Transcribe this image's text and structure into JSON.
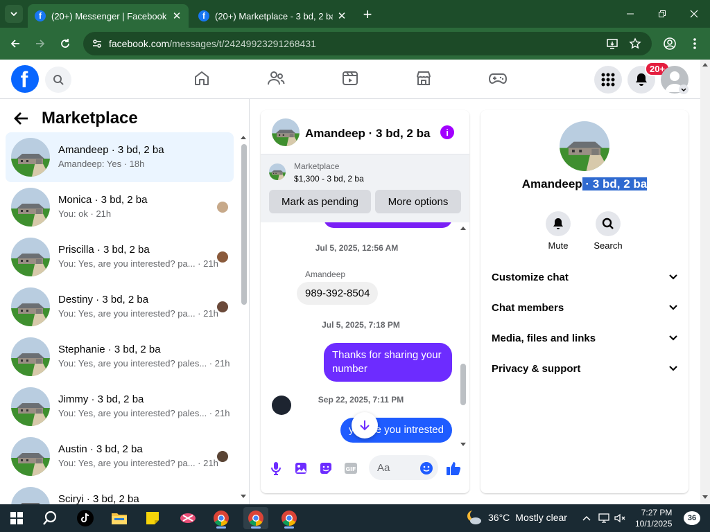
{
  "browser": {
    "tabs": [
      {
        "title": "(20+) Messenger | Facebook",
        "active": true
      },
      {
        "title": "(20+) Marketplace - 3 bd, 2 ba |",
        "active": false
      }
    ],
    "url_domain": "facebook.com",
    "url_path": "/messages/t/24249923291268431"
  },
  "fb_header": {
    "logo": "f",
    "notifications_badge": "20+",
    "nav_icons": [
      "home-icon",
      "friends-icon",
      "video-icon",
      "marketplace-icon",
      "gaming-icon"
    ]
  },
  "left_pane": {
    "title": "Marketplace",
    "conversations": [
      {
        "name": "Amandeep · 3 bd, 2 ba",
        "preview": "Amandeep: Yes · 18h",
        "selected": true
      },
      {
        "name": "Monica · 3 bd, 2 ba",
        "preview": "You: ok · 21h"
      },
      {
        "name": "Priscilla · 3 bd, 2 ba",
        "preview": "You: Yes, are you interested? pa... · 21h"
      },
      {
        "name": "Destiny · 3 bd, 2 ba",
        "preview": "You: Yes, are you interested? pa... · 21h"
      },
      {
        "name": "Stephanie · 3 bd, 2 ba",
        "preview": "You: Yes, are you interested? pales... · 21h"
      },
      {
        "name": "Jimmy · 3 bd, 2 ba",
        "preview": "You: Yes, are you interested? pales... · 21h"
      },
      {
        "name": "Austin · 3 bd, 2 ba",
        "preview": "You: Yes, are you interested? pa... · 21h"
      },
      {
        "name": "Sciryi · 3 bd, 2 ba",
        "preview": ""
      }
    ]
  },
  "chat": {
    "title": "Amandeep · 3 bd, 2 ba",
    "marketplace_label": "Marketplace",
    "listing": "$1,300 - 3 bd, 2 ba",
    "mark_pending": "Mark as pending",
    "more_options": "More options",
    "timestamp1": "Jul 5, 2025, 12:56 AM",
    "sender": "Amandeep",
    "incoming_msg": "989-392-8504",
    "timestamp2": "Jul 5, 2025, 7:18 PM",
    "outgoing_msg": "Thanks for sharing your number",
    "timestamp3": "Sep 22, 2025, 7:11 PM",
    "outgoing_msg2_left": "y",
    "outgoing_msg2_right": "e you intrested",
    "composer_placeholder": "Aa"
  },
  "info_panel": {
    "name_plain": "Amandeep",
    "name_highlight": " · 3 bd, 2 ba",
    "mute": "Mute",
    "search": "Search",
    "sections": [
      "Customize chat",
      "Chat members",
      "Media, files and links",
      "Privacy & support"
    ]
  },
  "taskbar": {
    "temperature": "36°C",
    "weather": "Mostly clear",
    "time": "7:27 PM",
    "date": "10/1/2025",
    "notification_count": "36"
  }
}
